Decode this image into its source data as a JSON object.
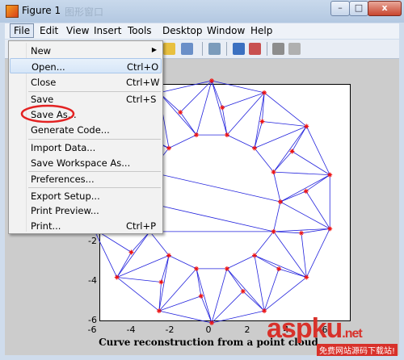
{
  "window": {
    "title": "Figure 1",
    "ghost_title": "图形窗口"
  },
  "window_buttons": {
    "minimize": "–",
    "maximize": "□",
    "close": "x"
  },
  "menubar": [
    "File",
    "Edit",
    "View",
    "Insert",
    "Tools",
    "Desktop",
    "Window",
    "Help"
  ],
  "file_menu": [
    {
      "label": "New",
      "shortcut": "",
      "submenu": true
    },
    {
      "label": "Open...",
      "shortcut": "Ctrl+O",
      "highlight": true
    },
    {
      "label": "Close",
      "shortcut": "Ctrl+W"
    },
    {
      "label": "Save",
      "shortcut": "Ctrl+S"
    },
    {
      "label": "Save As...",
      "shortcut": "",
      "circled": true
    },
    {
      "label": "Generate Code...",
      "shortcut": ""
    },
    {
      "label": "Import Data...",
      "shortcut": ""
    },
    {
      "label": "Save Workspace As...",
      "shortcut": ""
    },
    {
      "label": "Preferences...",
      "shortcut": ""
    },
    {
      "label": "Export Setup...",
      "shortcut": ""
    },
    {
      "label": "Print Preview...",
      "shortcut": ""
    },
    {
      "label": "Print...",
      "shortcut": "Ctrl+P"
    }
  ],
  "plot": {
    "yticks": [
      "-2",
      "-4",
      "-6"
    ],
    "xticks": [
      "-6",
      "-4",
      "-2",
      "0",
      "2",
      "4",
      "6"
    ],
    "xlabel": "Curve reconstruction from a point cloud",
    "line_color": "#2222dd",
    "marker_color": "#ee1111"
  },
  "watermark": {
    "text": "aspku",
    "suffix": ".net",
    "sub": "免费网站源码下载站!"
  },
  "annotation_color": "#e32222"
}
